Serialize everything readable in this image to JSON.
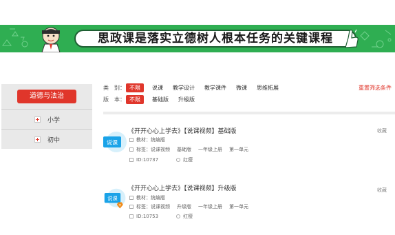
{
  "banner": {
    "title": "思政课是落实立德树人根本任务的关键课程"
  },
  "sidebar": {
    "subject": "道德与法治",
    "items": [
      {
        "label": "小学",
        "icon": "plus-icon"
      },
      {
        "label": "初中",
        "icon": "plus-icon"
      }
    ]
  },
  "filters": {
    "category_label": "类　别：",
    "category_options": [
      "不限",
      "说课",
      "教学设计",
      "教学课件",
      "微课",
      "思维拓展"
    ],
    "edition_label": "版　本：",
    "edition_options": [
      "不限",
      "基础版",
      "升级版"
    ],
    "reset": "重置筛选条件"
  },
  "resources": [
    {
      "title": "《开开心心上学去》【说课视频】基础版",
      "icon_label": "说课",
      "textbook": "教材：统编版",
      "tags_label": "标签：",
      "tags": [
        "说课视频",
        "基础版",
        "一年级上册",
        "第一单元"
      ],
      "id": "ID:10737",
      "author": "红瘦",
      "fav": "收藏",
      "accent": "#1aa3e8"
    },
    {
      "title": "《开开心心上学去》【说课视频】升级版",
      "icon_label": "说课",
      "textbook": "教材：统编版",
      "tags_label": "标签：",
      "tags": [
        "说课视频",
        "升级版",
        "一年级上册",
        "第一单元"
      ],
      "id": "ID:10753",
      "author": "红瘦",
      "fav": "收藏",
      "accent": "#1aa3e8"
    }
  ],
  "colors": {
    "accent_red": "#e0362b",
    "banner_green": "#2fae52",
    "icon_blue": "#1aa3e8",
    "badge_orange": "#f08a1a"
  }
}
